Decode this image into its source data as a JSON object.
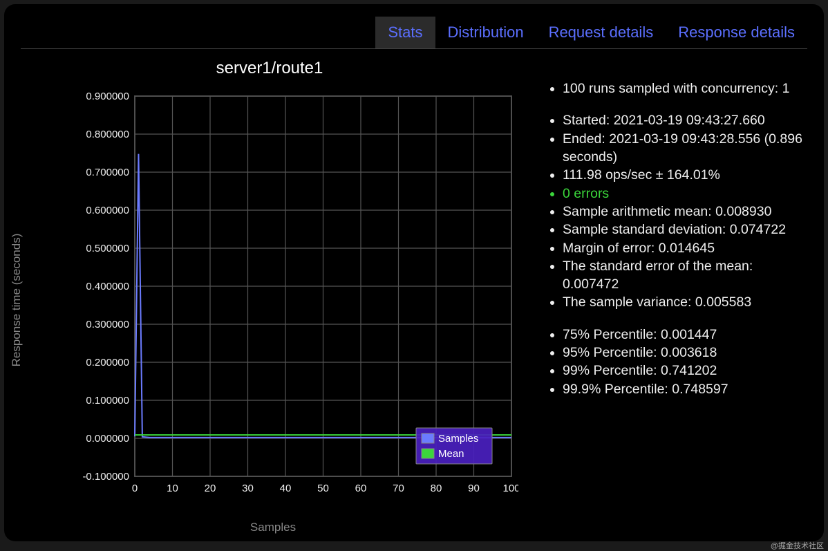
{
  "tabs": {
    "stats": "Stats",
    "distribution": "Distribution",
    "request": "Request details",
    "response": "Response details"
  },
  "chart": {
    "title": "server1/route1",
    "ylabel": "Response time (seconds)",
    "xlabel": "Samples",
    "legend": {
      "samples": "Samples",
      "mean": "Mean"
    }
  },
  "stats": {
    "runs": "100 runs sampled with concurrency: 1",
    "started": "Started: 2021-03-19 09:43:27.660",
    "ended": "Ended: 2021-03-19 09:43:28.556 (0.896 seconds)",
    "ops": "111.98 ops/sec ± 164.01%",
    "errors": "0 errors",
    "mean": "Sample arithmetic mean: 0.008930",
    "stddev": "Sample standard deviation: 0.074722",
    "moe": "Margin of error: 0.014645",
    "sem": "The standard error of the mean: 0.007472",
    "variance": "The sample variance: 0.005583",
    "p75": "75% Percentile: 0.001447",
    "p95": "95% Percentile: 0.003618",
    "p99": "99% Percentile: 0.741202",
    "p999": "99.9% Percentile: 0.748597"
  },
  "watermark": "@掘金技术社区",
  "chart_data": {
    "type": "line",
    "title": "server1/route1",
    "xlabel": "Samples",
    "ylabel": "Response time (seconds)",
    "xlim": [
      0,
      100
    ],
    "ylim": [
      -0.1,
      0.9
    ],
    "x_ticks": [
      0,
      10,
      20,
      30,
      40,
      50,
      60,
      70,
      80,
      90,
      100
    ],
    "y_ticks": [
      -0.1,
      0.0,
      0.1,
      0.2,
      0.3,
      0.4,
      0.5,
      0.6,
      0.7,
      0.8,
      0.9
    ],
    "series": [
      {
        "name": "Samples",
        "color": "#6b7bff",
        "x": [
          0,
          1,
          2,
          3,
          4,
          5,
          6,
          7,
          8,
          9,
          10,
          20,
          30,
          40,
          50,
          60,
          70,
          80,
          90,
          100
        ],
        "y": [
          0.005,
          0.748,
          0.004,
          0.003,
          0.002,
          0.002,
          0.002,
          0.002,
          0.002,
          0.002,
          0.002,
          0.002,
          0.002,
          0.002,
          0.002,
          0.002,
          0.002,
          0.002,
          0.002,
          0.002
        ]
      },
      {
        "name": "Mean",
        "color": "#3bd63b",
        "x": [
          0,
          100
        ],
        "y": [
          0.00893,
          0.00893
        ]
      }
    ]
  }
}
